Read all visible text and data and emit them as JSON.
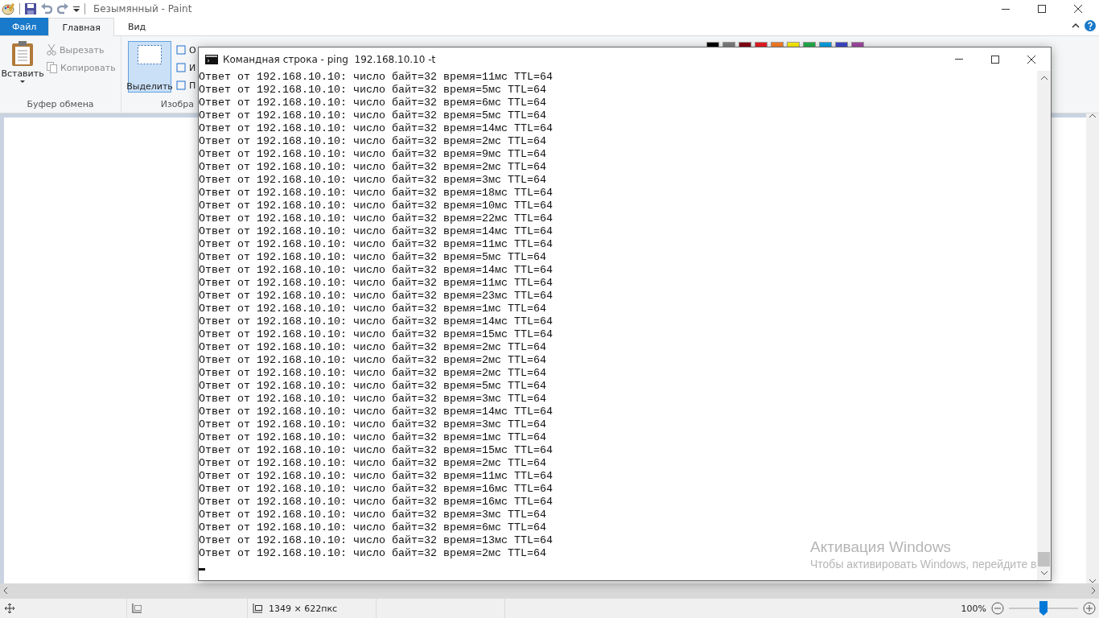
{
  "paint": {
    "title": "Безымянный - Paint",
    "tabs": [
      {
        "label": "Файл",
        "kind": "file",
        "selected": false
      },
      {
        "label": "Главная",
        "kind": "tab",
        "selected": true
      },
      {
        "label": "Вид",
        "kind": "tab",
        "selected": false
      }
    ],
    "clipboard": {
      "paste": "Вставить",
      "cut": {
        "label": "Вырезать",
        "disabled": true
      },
      "copy": {
        "label": "Копировать",
        "disabled": true
      },
      "group": "Буфер обмена"
    },
    "select": {
      "label": "Выделить",
      "selected": true
    },
    "image_group": {
      "items": [
        "О",
        "И",
        "П"
      ],
      "group": "Изобра"
    },
    "palette": [
      {
        "color": "#000000"
      },
      {
        "color": "#7f7f7f"
      },
      {
        "color": "#880015"
      },
      {
        "color": "#ed1c24"
      },
      {
        "color": "#ff7f27"
      },
      {
        "color": "#fff200"
      },
      {
        "color": "#22b14c"
      },
      {
        "color": "#00a2e8"
      },
      {
        "color": "#3f48cc"
      },
      {
        "color": "#a349a4"
      }
    ],
    "status": {
      "size": "1349 × 622пкс",
      "zoom": "100%",
      "zoom_slider": {
        "level": 0.5
      }
    }
  },
  "cmd": {
    "title": "Командная строка - ping  192.168.10.10 -t",
    "lines": [
      "Ответ от 192.168.10.10: число байт=32 время=11мс TTL=64",
      "Ответ от 192.168.10.10: число байт=32 время=5мс TTL=64",
      "Ответ от 192.168.10.10: число байт=32 время=6мс TTL=64",
      "Ответ от 192.168.10.10: число байт=32 время=5мс TTL=64",
      "Ответ от 192.168.10.10: число байт=32 время=14мс TTL=64",
      "Ответ от 192.168.10.10: число байт=32 время=2мс TTL=64",
      "Ответ от 192.168.10.10: число байт=32 время=9мс TTL=64",
      "Ответ от 192.168.10.10: число байт=32 время=2мс TTL=64",
      "Ответ от 192.168.10.10: число байт=32 время=3мс TTL=64",
      "Ответ от 192.168.10.10: число байт=32 время=18мс TTL=64",
      "Ответ от 192.168.10.10: число байт=32 время=10мс TTL=64",
      "Ответ от 192.168.10.10: число байт=32 время=22мс TTL=64",
      "Ответ от 192.168.10.10: число байт=32 время=14мс TTL=64",
      "Ответ от 192.168.10.10: число байт=32 время=11мс TTL=64",
      "Ответ от 192.168.10.10: число байт=32 время=5мс TTL=64",
      "Ответ от 192.168.10.10: число байт=32 время=14мс TTL=64",
      "Ответ от 192.168.10.10: число байт=32 время=11мс TTL=64",
      "Ответ от 192.168.10.10: число байт=32 время=23мс TTL=64",
      "Ответ от 192.168.10.10: число байт=32 время=1мс TTL=64",
      "Ответ от 192.168.10.10: число байт=32 время=14мс TTL=64",
      "Ответ от 192.168.10.10: число байт=32 время=15мс TTL=64",
      "Ответ от 192.168.10.10: число байт=32 время=2мс TTL=64",
      "Ответ от 192.168.10.10: число байт=32 время=2мс TTL=64",
      "Ответ от 192.168.10.10: число байт=32 время=2мс TTL=64",
      "Ответ от 192.168.10.10: число байт=32 время=5мс TTL=64",
      "Ответ от 192.168.10.10: число байт=32 время=3мс TTL=64",
      "Ответ от 192.168.10.10: число байт=32 время=14мс TTL=64",
      "Ответ от 192.168.10.10: число байт=32 время=3мс TTL=64",
      "Ответ от 192.168.10.10: число байт=32 время=1мс TTL=64",
      "Ответ от 192.168.10.10: число байт=32 время=15мс TTL=64",
      "Ответ от 192.168.10.10: число байт=32 время=2мс TTL=64",
      "Ответ от 192.168.10.10: число байт=32 время=11мс TTL=64",
      "Ответ от 192.168.10.10: число байт=32 время=16мс TTL=64",
      "Ответ от 192.168.10.10: число байт=32 время=16мс TTL=64",
      "Ответ от 192.168.10.10: число байт=32 время=3мс TTL=64",
      "Ответ от 192.168.10.10: число байт=32 время=6мс TTL=64",
      "Ответ от 192.168.10.10: число байт=32 время=13мс TTL=64",
      "Ответ от 192.168.10.10: число байт=32 время=2мс TTL=64"
    ]
  },
  "activation": {
    "title": "Активация Windows",
    "text": "Чтобы активировать Windows, перейдите в"
  }
}
